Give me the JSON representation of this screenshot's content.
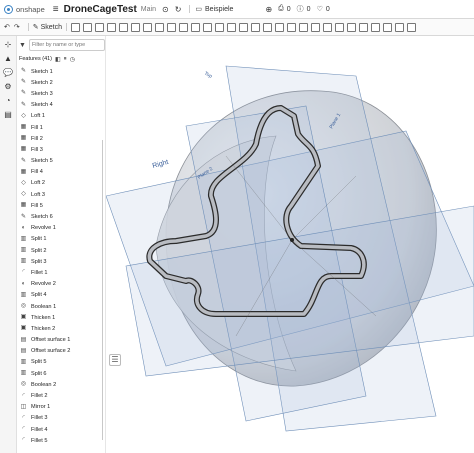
{
  "app": {
    "brand": "onshape",
    "doc_title": "DroneCageTest",
    "branch": "Main"
  },
  "topbar": {
    "folder_label": "Beispiele",
    "counts": [
      "0",
      "0",
      "0"
    ]
  },
  "toolbar": {
    "sketch_label": "Sketch"
  },
  "panel": {
    "filter_placeholder": "Filter by name or type",
    "features_label": "Features (41)",
    "items": [
      {
        "label": "Sketch 1",
        "icon": "sketch-icon"
      },
      {
        "label": "Sketch 2",
        "icon": "sketch-icon"
      },
      {
        "label": "Sketch 3",
        "icon": "sketch-icon"
      },
      {
        "label": "Sketch 4",
        "icon": "sketch-icon"
      },
      {
        "label": "Loft 1",
        "icon": "loft-icon"
      },
      {
        "label": "Fill 1",
        "icon": "fill-icon"
      },
      {
        "label": "Fill 2",
        "icon": "fill-icon"
      },
      {
        "label": "Fill 3",
        "icon": "fill-icon"
      },
      {
        "label": "Sketch 5",
        "icon": "sketch-icon"
      },
      {
        "label": "Fill 4",
        "icon": "fill-icon"
      },
      {
        "label": "Loft 2",
        "icon": "loft-icon"
      },
      {
        "label": "Loft 3",
        "icon": "loft-icon"
      },
      {
        "label": "Fill 5",
        "icon": "fill-icon"
      },
      {
        "label": "Sketch 6",
        "icon": "sketch-icon"
      },
      {
        "label": "Revolve 1",
        "icon": "revolve-icon"
      },
      {
        "label": "Split 1",
        "icon": "split-icon"
      },
      {
        "label": "Split 2",
        "icon": "split-icon"
      },
      {
        "label": "Split 3",
        "icon": "split-icon"
      },
      {
        "label": "Fillet 1",
        "icon": "fillet-icon"
      },
      {
        "label": "Revolve 2",
        "icon": "revolve-icon"
      },
      {
        "label": "Split 4",
        "icon": "split-icon"
      },
      {
        "label": "Boolean 1",
        "icon": "boolean-icon"
      },
      {
        "label": "Thicken 1",
        "icon": "thicken-icon"
      },
      {
        "label": "Thicken 2",
        "icon": "thicken-icon"
      },
      {
        "label": "Offset surface 1",
        "icon": "offset-icon"
      },
      {
        "label": "Offset surface 2",
        "icon": "offset-icon"
      },
      {
        "label": "Split 5",
        "icon": "split-icon"
      },
      {
        "label": "Split 6",
        "icon": "split-icon"
      },
      {
        "label": "Boolean 2",
        "icon": "boolean-icon"
      },
      {
        "label": "Fillet 2",
        "icon": "fillet-icon"
      },
      {
        "label": "Mirror 1",
        "icon": "mirror-icon"
      },
      {
        "label": "Fillet 3",
        "icon": "fillet-icon"
      },
      {
        "label": "Fillet 4",
        "icon": "fillet-icon"
      },
      {
        "label": "Fillet 5",
        "icon": "fillet-icon"
      }
    ]
  },
  "viewport": {
    "plane_labels": [
      "Right",
      "Plane 1",
      "Plane 2",
      "Top"
    ],
    "colors": {
      "plane": "#9fb8d6",
      "body": "#c9ccd2",
      "edge": "#2b2b2b"
    }
  }
}
